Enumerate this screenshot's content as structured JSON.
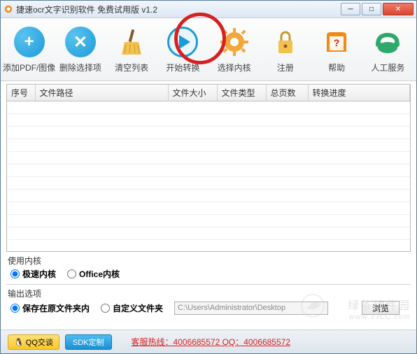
{
  "titlebar": {
    "title": "捷速ocr文字识别软件 免费试用版 v1.2"
  },
  "toolbar": {
    "add": "添加PDF/图像",
    "delete": "删除选择项",
    "clear": "清空列表",
    "start": "开始转换",
    "engine": "选择内核",
    "register": "注册",
    "help": "帮助",
    "service": "人工服务"
  },
  "table": {
    "headers": {
      "index": "序号",
      "path": "文件路径",
      "size": "文件大小",
      "type": "文件类型",
      "pages": "总页数",
      "progress": "转换进度"
    }
  },
  "engine_section": {
    "label": "使用内核",
    "fast": "极速内核",
    "office": "Office内核"
  },
  "output_section": {
    "label": "输出选项",
    "same_folder": "保存在原文件夹内",
    "custom_folder": "自定义文件夹",
    "path": "C:\\Users\\Administrator\\Desktop",
    "browse": "浏览"
  },
  "footer": {
    "qq": "QQ交谈",
    "sdk": "SDK定制",
    "hotline": "客服热线：4006685572 QQ：4006685572"
  },
  "watermark": {
    "brand": "绿茶软件园",
    "url": "www.33LC.com"
  }
}
